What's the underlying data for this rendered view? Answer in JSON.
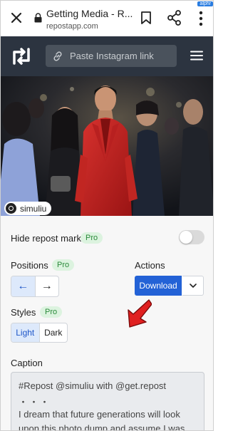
{
  "browser": {
    "title": "Getting Media - R...",
    "url": "repostapp.com",
    "watermark": "alphr"
  },
  "app": {
    "search_placeholder": "Paste Instagram link"
  },
  "photo": {
    "username": "simuliu"
  },
  "options": {
    "hide_repost_mark": {
      "label": "Hide repost mark",
      "badge": "Pro",
      "enabled": false
    },
    "positions": {
      "label": "Positions",
      "badge": "Pro",
      "left_arrow": "←",
      "right_arrow": "→",
      "selected": "left"
    },
    "actions": {
      "label": "Actions",
      "download_label": "Download"
    },
    "styles": {
      "label": "Styles",
      "badge": "Pro",
      "light_label": "Light",
      "dark_label": "Dark",
      "selected": "Light"
    },
    "caption": {
      "label": "Caption",
      "line1": "#Repost @simuliu with @get.repost",
      "line2": "・・・",
      "line3": "I dream that future generations will look",
      "line4": "upon this photo dump and assume I was"
    }
  },
  "colors": {
    "header_bg": "#2c3440",
    "accent_blue": "#2362d6",
    "pro_green": "#2a8a3a",
    "pointer_red": "#e02020"
  }
}
